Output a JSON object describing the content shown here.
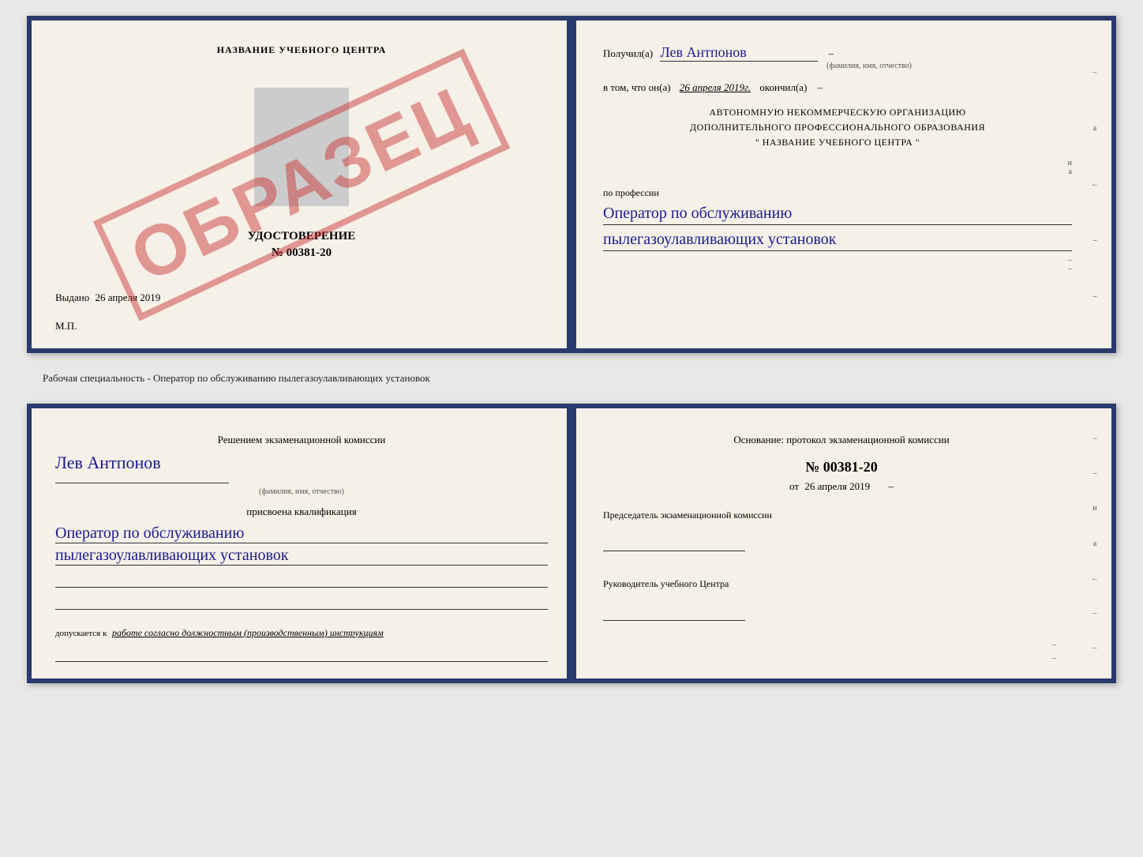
{
  "page": {
    "background": "#e8e8e8"
  },
  "top_document": {
    "left": {
      "title": "НАЗВАНИЕ УЧЕБНОГО ЦЕНТРА",
      "certificate_label": "УДОСТОВЕРЕНИЕ",
      "certificate_number": "№ 00381-20",
      "issued_label": "Выдано",
      "issued_date": "26 апреля 2019",
      "mp_label": "М.П.",
      "stamp_text": "ОБРАЗЕЦ"
    },
    "right": {
      "received_label": "Получил(а)",
      "person_name": "Лев Антпонов",
      "name_subtext": "(фамилия, имя, отчество)",
      "in_that_label": "в том, что он(а)",
      "date_completed": "26 апреля 2019г.",
      "completed_label": "окончил(а)",
      "org_line1": "АВТОНОМНУЮ НЕКОММЕРЧЕСКУЮ ОРГАНИЗАЦИЮ",
      "org_line2": "ДОПОЛНИТЕЛЬНОГО ПРОФЕССИОНАЛЬНОГО ОБРАЗОВАНИЯ",
      "org_line3": "\"  НАЗВАНИЕ УЧЕБНОГО ЦЕНТРА  \"",
      "profession_label": "по профессии",
      "profession_line1": "Оператор по обслуживанию",
      "profession_line2": "пылегазоулавливающих установок"
    }
  },
  "separator": {
    "text": "Рабочая специальность - Оператор по обслуживанию пылегазоулавливающих установок"
  },
  "bottom_document": {
    "left": {
      "heading": "Решением экзаменационной комиссии",
      "person_name": "Лев Антпонов",
      "name_subtext": "(фамилия, имя, отчество)",
      "assigned_label": "присвоена квалификация",
      "qualification_line1": "Оператор по обслуживанию",
      "qualification_line2": "пылегазоулавливающих установок",
      "allow_prefix": "допускается к",
      "allow_text": "работе согласно должностным (производственным) инструкциям"
    },
    "right": {
      "basis_label": "Основание: протокол экзаменационной комиссии",
      "protocol_number": "№ 00381-20",
      "date_prefix": "от",
      "protocol_date": "26 апреля 2019",
      "chairman_label": "Председатель экзаменационной комиссии",
      "director_label": "Руководитель учебного Центра"
    }
  },
  "side_marks": [
    "–",
    "а",
    "←",
    "–",
    "–",
    "и",
    "а",
    "←",
    "–",
    "–"
  ]
}
